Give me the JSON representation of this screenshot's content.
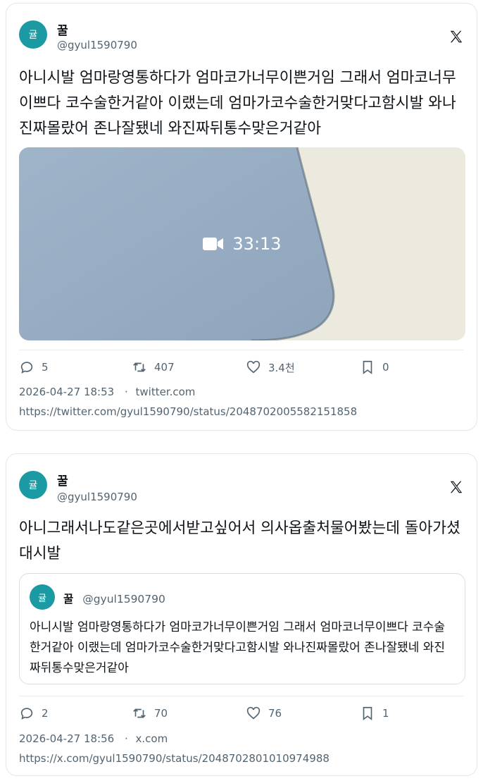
{
  "tweets": [
    {
      "avatar_text": "귤",
      "name": "꿀",
      "handle": "@gyul1590790",
      "text": "아니시발 엄마랑영통하다가 엄마코가너무이쁜거임 그래서 엄마코너무이쁘다 코수술한거같아 이랬는데 엄마가코수술한거맞다고함시발 와나진짜몰랐어 존나잘됐네 와진짜뒤통수맞은거같아",
      "media": {
        "type": "video",
        "duration": "33:13",
        "icon": "video-camera-icon"
      },
      "stats": {
        "replies": "5",
        "retweets": "407",
        "likes": "3.4천",
        "bookmarks": "0"
      },
      "date": "2026-04-27 18:53",
      "source": "twitter.com",
      "url": "https://twitter.com/gyul1590790/status/2048702005582151858"
    },
    {
      "avatar_text": "귤",
      "name": "꿀",
      "handle": "@gyul1590790",
      "text": "아니그래서나도같은곳에서받고싶어서 의사옵출처물어봤는데 돌아가셨대시발",
      "quote": {
        "avatar_text": "귤",
        "name": "꿀",
        "handle": "@gyul1590790",
        "text": "아니시발 엄마랑영통하다가 엄마코가너무이쁜거임 그래서 엄마코너무이쁘다 코수술한거같아 이랬는데 엄마가코수술한거맞다고함시발 와나진짜몰랐어 존나잘됐네 와진짜뒤통수맞은거같아"
      },
      "stats": {
        "replies": "2",
        "retweets": "70",
        "likes": "76",
        "bookmarks": "1"
      },
      "date": "2026-04-27 18:56",
      "source": "x.com",
      "url": "https://x.com/gyul1590790/status/2048702801010974988"
    }
  ],
  "colors": {
    "avatar": "#1b9aa3",
    "text": "#0f1419",
    "muted": "#536471",
    "border": "#e1e8ed"
  }
}
